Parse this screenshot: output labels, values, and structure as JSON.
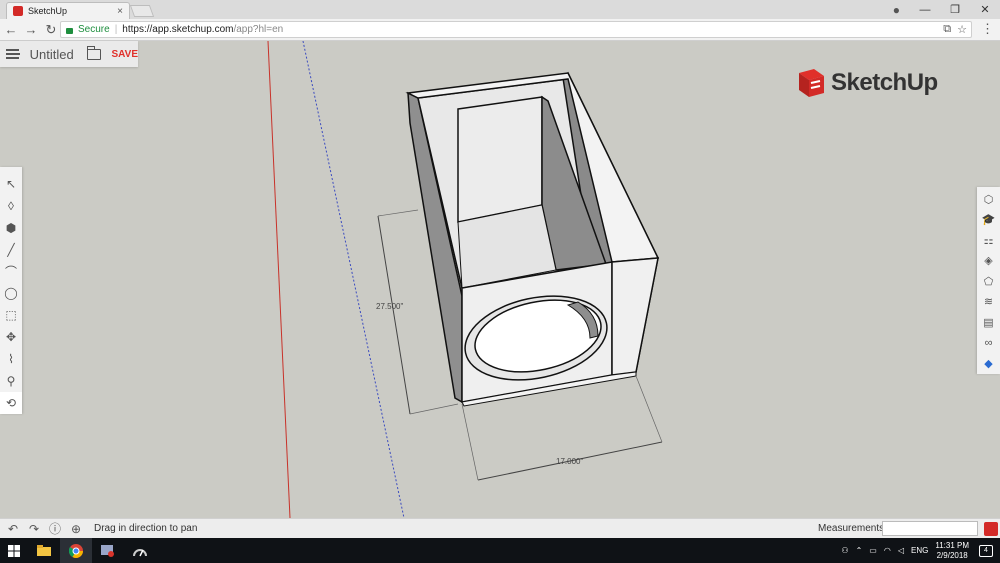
{
  "browser": {
    "tab_title": "SketchUp",
    "tab_close": "×",
    "secure_label": "Secure",
    "url_host": "https://app.sketchup.com",
    "url_path": "/app?hl=en",
    "window_controls": {
      "minimize": "—",
      "restore": "❐",
      "close": "✕"
    },
    "profile_glyph": "●"
  },
  "app": {
    "document_title": "Untitled",
    "save_label": "SAVE",
    "logo_text": "SketchUp"
  },
  "left_tools": [
    {
      "name": "select",
      "glyph": "↖"
    },
    {
      "name": "eraser",
      "glyph": "◊"
    },
    {
      "name": "paint",
      "glyph": "⬢"
    },
    {
      "name": "line",
      "glyph": "╱"
    },
    {
      "name": "arc",
      "glyph": "⌒"
    },
    {
      "name": "circle",
      "glyph": "◯"
    },
    {
      "name": "push-pull",
      "glyph": "⬚"
    },
    {
      "name": "move",
      "glyph": "✥"
    },
    {
      "name": "tape-measure",
      "glyph": "⌇"
    },
    {
      "name": "walk",
      "glyph": "⚲"
    },
    {
      "name": "orbit",
      "glyph": "⟲"
    }
  ],
  "right_tools": [
    {
      "name": "entity-info",
      "glyph": "⬡"
    },
    {
      "name": "instructor",
      "glyph": "🎓"
    },
    {
      "name": "components",
      "glyph": "⚏"
    },
    {
      "name": "materials",
      "glyph": "◈"
    },
    {
      "name": "styles",
      "glyph": "⬠"
    },
    {
      "name": "layers",
      "glyph": "≋"
    },
    {
      "name": "scenes",
      "glyph": "▤"
    },
    {
      "name": "display",
      "glyph": "∞"
    },
    {
      "name": "3d-warehouse",
      "glyph": "◆"
    }
  ],
  "model": {
    "dim_height": "27.500\"",
    "dim_width": "17.000\""
  },
  "status": {
    "message": "Drag in direction to pan",
    "measurements_label": "Measurements",
    "measurements_value": ""
  },
  "taskbar": {
    "lang": "ENG",
    "time": "11:31 PM",
    "date": "2/9/2018",
    "notif_count": "4"
  },
  "colors": {
    "brand_red": "#d32a27",
    "viewport_bg": "#cbcbc5",
    "red_axis": "#c8322a",
    "blue_axis": "#3b4bbf"
  }
}
